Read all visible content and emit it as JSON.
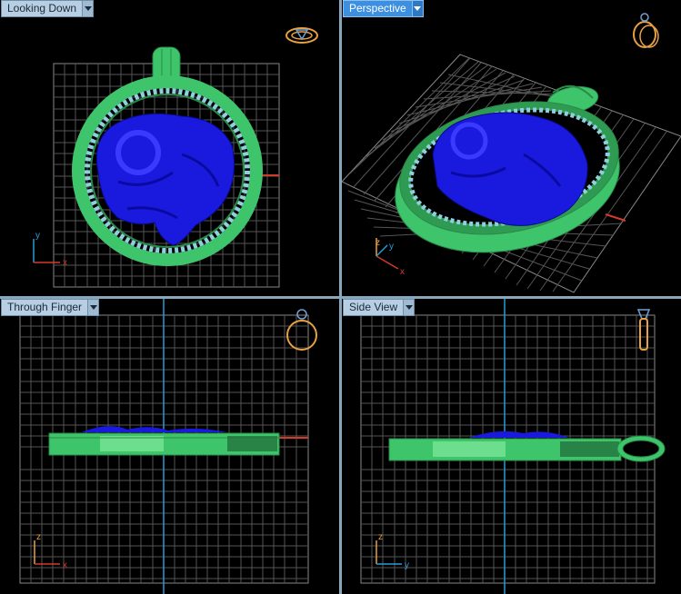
{
  "viewports": {
    "top": {
      "label": "Looking Down",
      "axis_h": "x",
      "axis_v": "y",
      "orientation_icon": "ring-top-icon"
    },
    "persp": {
      "label": "Perspective",
      "axis_h": "x",
      "axis_v": "z",
      "axis_d": "y",
      "orientation_icon": "ring-perspective-icon"
    },
    "front": {
      "label": "Through Finger",
      "axis_h": "x",
      "axis_v": "z",
      "orientation_icon": "ring-front-icon"
    },
    "side": {
      "label": "Side View",
      "axis_h": "y",
      "axis_v": "z",
      "orientation_icon": "ring-side-icon"
    }
  },
  "active_viewport": "persp",
  "colors": {
    "background": "#000000",
    "grid": "#5a5a5a",
    "grid_major": "#8a8a8a",
    "model_body": "#1a1adf",
    "model_frame": "#3ec46a",
    "gem": "#8fd0e0",
    "axis_x": "#d23a2a",
    "axis_y": "#2a9ad8",
    "axis_z": "#e8a040",
    "active_label": "#3d8fe0",
    "inactive_label": "#b8cfe3"
  }
}
